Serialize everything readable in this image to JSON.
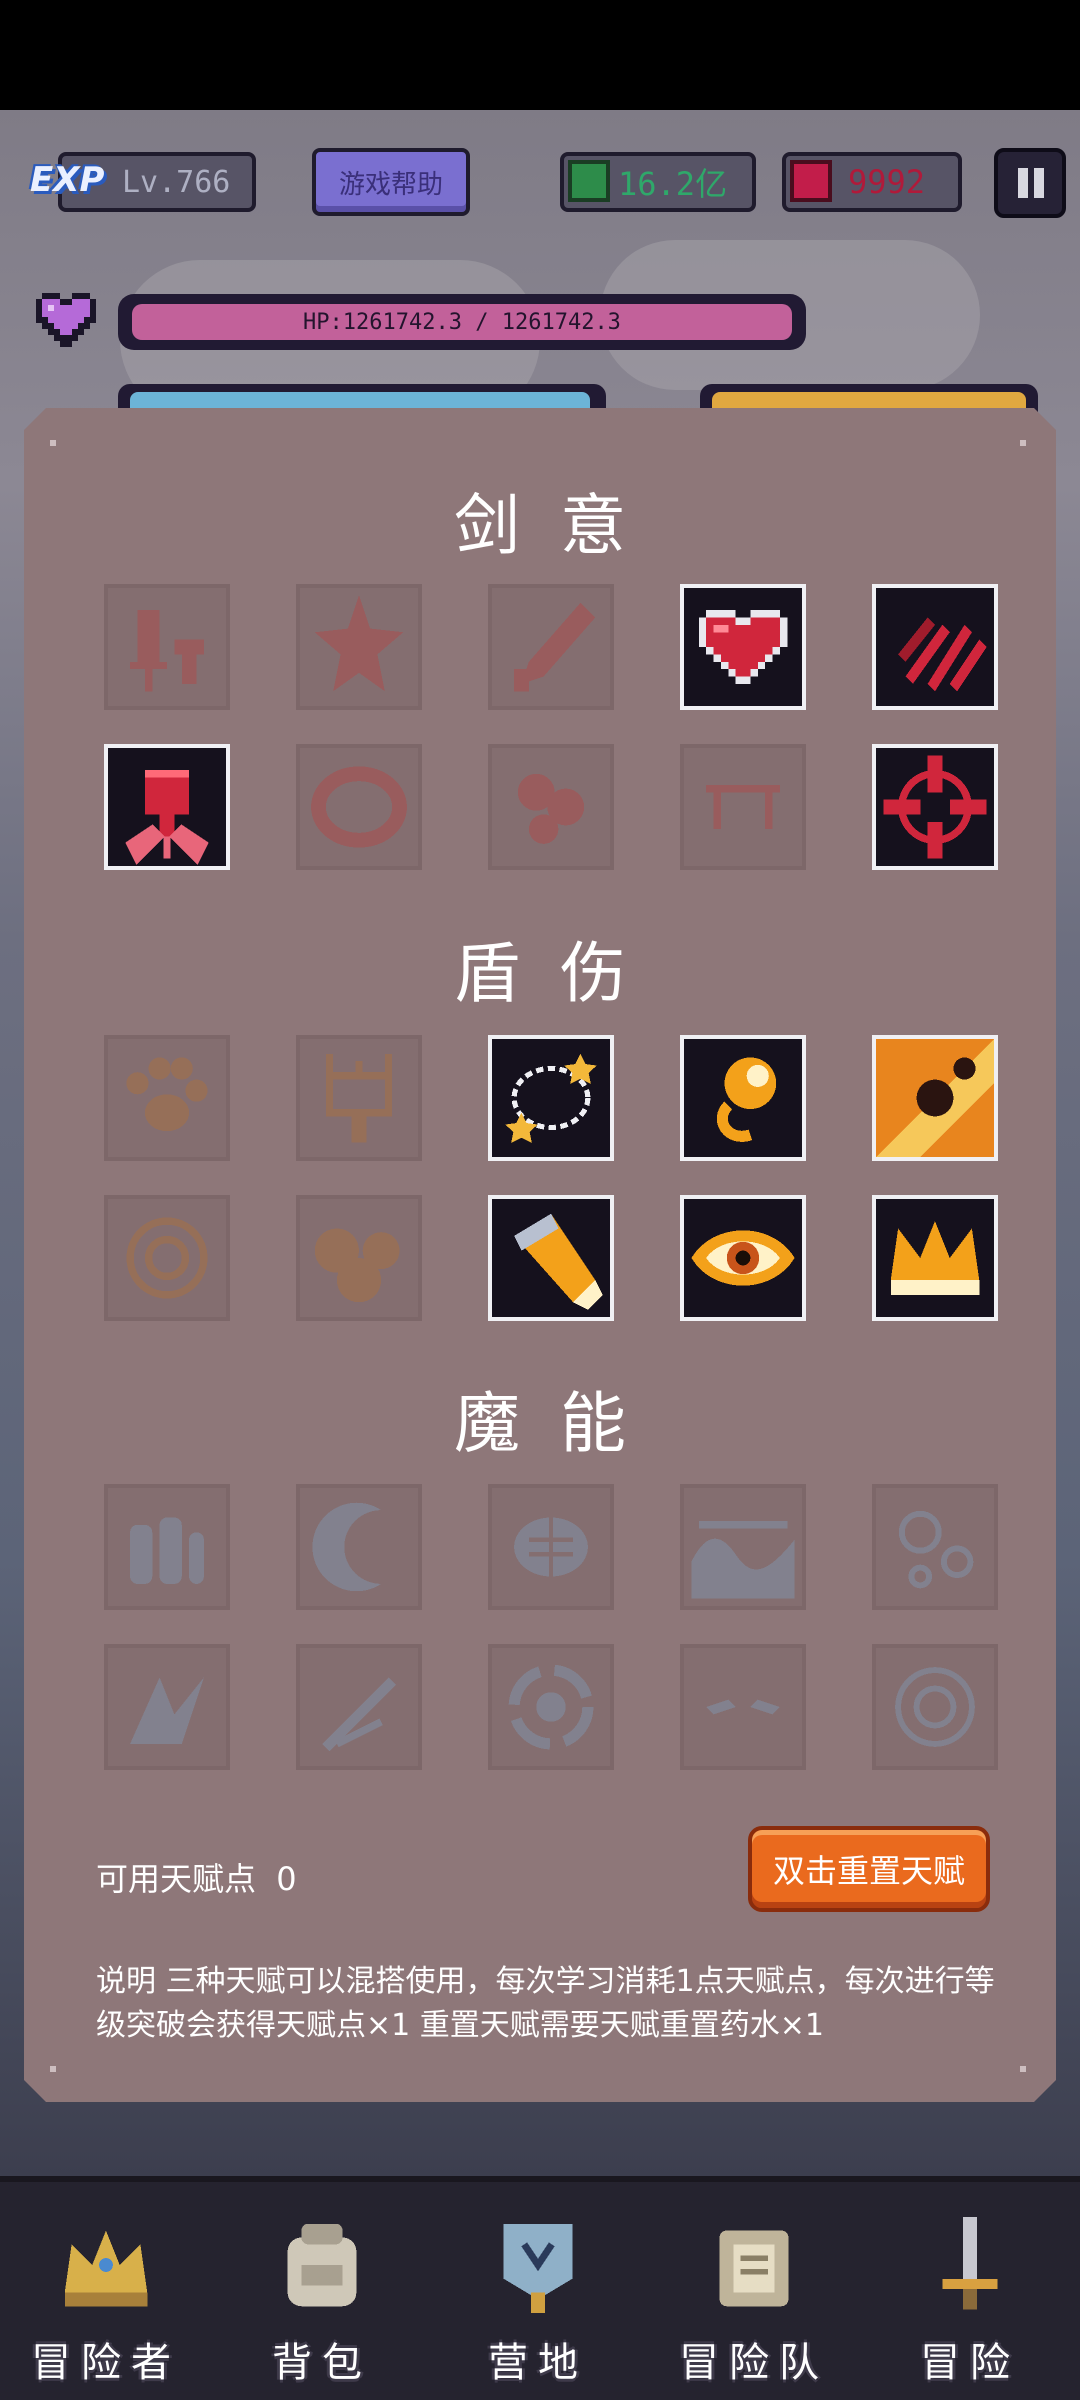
{
  "hud": {
    "exp_label": "EXP",
    "level": "Lv.766",
    "help_button": "游戏帮助",
    "gems": "16.2亿",
    "rubies": "9992",
    "hp_text": "HP:1261742.3 / 1261742.3"
  },
  "sections": [
    {
      "title": "剑意",
      "slots": [
        {
          "icon": "sword-icon",
          "active": false
        },
        {
          "icon": "starfish-icon",
          "active": false
        },
        {
          "icon": "blade-icon",
          "active": false
        },
        {
          "icon": "heart-icon",
          "active": true
        },
        {
          "icon": "claw-slash-icon",
          "active": true
        },
        {
          "icon": "fist-icon",
          "active": true
        },
        {
          "icon": "ring-icon",
          "active": false
        },
        {
          "icon": "blood-drops-icon",
          "active": false
        },
        {
          "icon": "fangs-icon",
          "active": false
        },
        {
          "icon": "crosshair-icon",
          "active": true
        }
      ]
    },
    {
      "title": "盾伤",
      "slots": [
        {
          "icon": "paw-icon",
          "active": false
        },
        {
          "icon": "totem-icon",
          "active": false
        },
        {
          "icon": "star-ring-icon",
          "active": true
        },
        {
          "icon": "golden-orb-icon",
          "active": true
        },
        {
          "icon": "meteor-icon",
          "active": true
        },
        {
          "icon": "coin-icon",
          "active": false
        },
        {
          "icon": "boulders-icon",
          "active": false
        },
        {
          "icon": "bullet-icon",
          "active": true
        },
        {
          "icon": "eye-icon",
          "active": true
        },
        {
          "icon": "crown-icon",
          "active": true
        }
      ]
    },
    {
      "title": "魔能",
      "slots": [
        {
          "icon": "potions-icon",
          "active": false
        },
        {
          "icon": "crescent-icon",
          "active": false
        },
        {
          "icon": "brain-icon",
          "active": false
        },
        {
          "icon": "wave-icon",
          "active": false
        },
        {
          "icon": "bubbles-icon",
          "active": false
        },
        {
          "icon": "ice-shard-icon",
          "active": false
        },
        {
          "icon": "frost-blade-icon",
          "active": false
        },
        {
          "icon": "vortex-icon",
          "active": false
        },
        {
          "icon": "masked-eyes-icon",
          "active": false
        },
        {
          "icon": "rune-circle-icon",
          "active": false
        }
      ]
    }
  ],
  "talent_points_label": "可用天赋点",
  "talent_points": "0",
  "reset_button": "双击重置天赋",
  "description": "说明 三种天赋可以混搭使用，每次学习消耗1点天赋点，每次进行等级突破会获得天赋点×1 重置天赋需要天赋重置药水×1",
  "nav": [
    {
      "label": "冒险者",
      "icon": "crown-icon"
    },
    {
      "label": "背包",
      "icon": "backpack-icon"
    },
    {
      "label": "营地",
      "icon": "camp-banner-icon"
    },
    {
      "label": "冒险队",
      "icon": "scroll-book-icon"
    },
    {
      "label": "冒险",
      "icon": "sword-icon"
    }
  ],
  "colors": {
    "panel": "#8e7779",
    "reset_button": "#ea6a1e",
    "hp_fill": "#c2619a",
    "gem": "#2fa86a",
    "ruby": "#b01a3a"
  }
}
